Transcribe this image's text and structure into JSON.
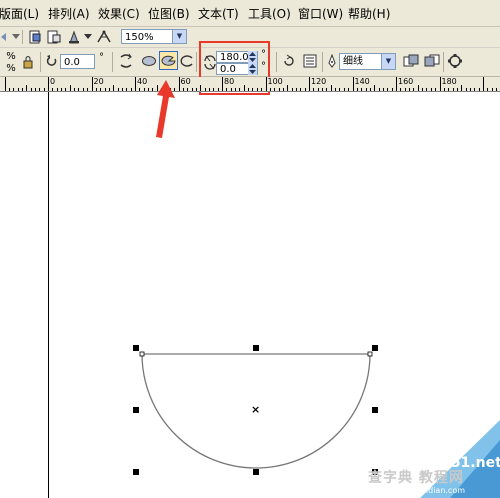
{
  "menu": {
    "items": [
      "版面(L)",
      "排列(A)",
      "效果(C)",
      "位图(B)",
      "文本(T)",
      "工具(O)",
      "窗口(W)",
      "帮助(H)"
    ]
  },
  "toolbar1": {
    "zoom_value": "150%"
  },
  "property_bar": {
    "rotation_value": "0.0",
    "rotation_unit": "°",
    "start_angle_value": "180.0",
    "end_angle_value": "0.0",
    "degree_symbol": "°",
    "outline_width_value": "细线",
    "ellipse_mode": "pie",
    "highlight_color": "#e8392b"
  },
  "ruler": {
    "labels": [
      "0",
      "20",
      "40",
      "60",
      "80",
      "100",
      "120",
      "140",
      "160",
      "180"
    ]
  },
  "canvas": {
    "shape": "pie (half ellipse)",
    "center_marker": "×"
  },
  "watermark": {
    "line1": "查字典 教程网",
    "line2": "jiaocheng.chazidian.com",
    "site": "jb51.net"
  }
}
